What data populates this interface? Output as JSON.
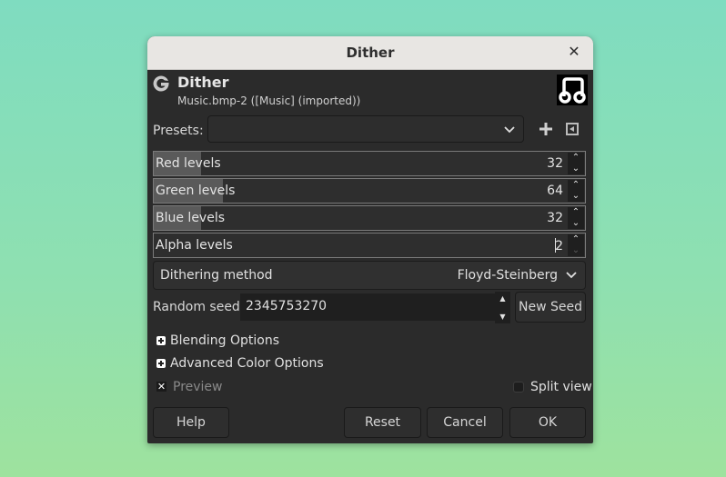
{
  "window": {
    "title": "Dither",
    "close_icon": "close-icon"
  },
  "header": {
    "title": "Dither",
    "subtitle": "Music.bmp-2 ([Music] (imported))",
    "logo_icon": "gimp-logo-icon",
    "thumbnail_icon": "music-note-icon"
  },
  "presets": {
    "label": "Presets:",
    "value": "",
    "add_icon": "plus-icon",
    "menu_icon": "menu-triangle-icon"
  },
  "levels": [
    {
      "label": "Red levels",
      "value": "32",
      "fraction": 0.11,
      "down_enabled": true
    },
    {
      "label": "Green levels",
      "value": "64",
      "fraction": 0.16,
      "down_enabled": true
    },
    {
      "label": "Blue levels",
      "value": "32",
      "fraction": 0.11,
      "down_enabled": true
    },
    {
      "label": "Alpha levels",
      "value": "2",
      "fraction": 0.0,
      "down_enabled": false
    }
  ],
  "dithering_method": {
    "label": "Dithering method",
    "value": "Floyd-Steinberg"
  },
  "random_seed": {
    "label": "Random seed",
    "value": "2345753270",
    "new_seed_label": "New Seed"
  },
  "expanders": [
    {
      "label": "Blending Options",
      "expanded": false
    },
    {
      "label": "Advanced Color Options",
      "expanded": false
    }
  ],
  "preview": {
    "label": "Preview",
    "checked": true
  },
  "split_view": {
    "label": "Split view",
    "checked": false
  },
  "buttons": {
    "help": "Help",
    "reset": "Reset",
    "cancel": "Cancel",
    "ok": "OK"
  },
  "colors": {
    "dialog_bg": "#2b2b2b",
    "titlebar_bg": "#e8e6e3",
    "slider_fill": "#5a5a5a"
  }
}
